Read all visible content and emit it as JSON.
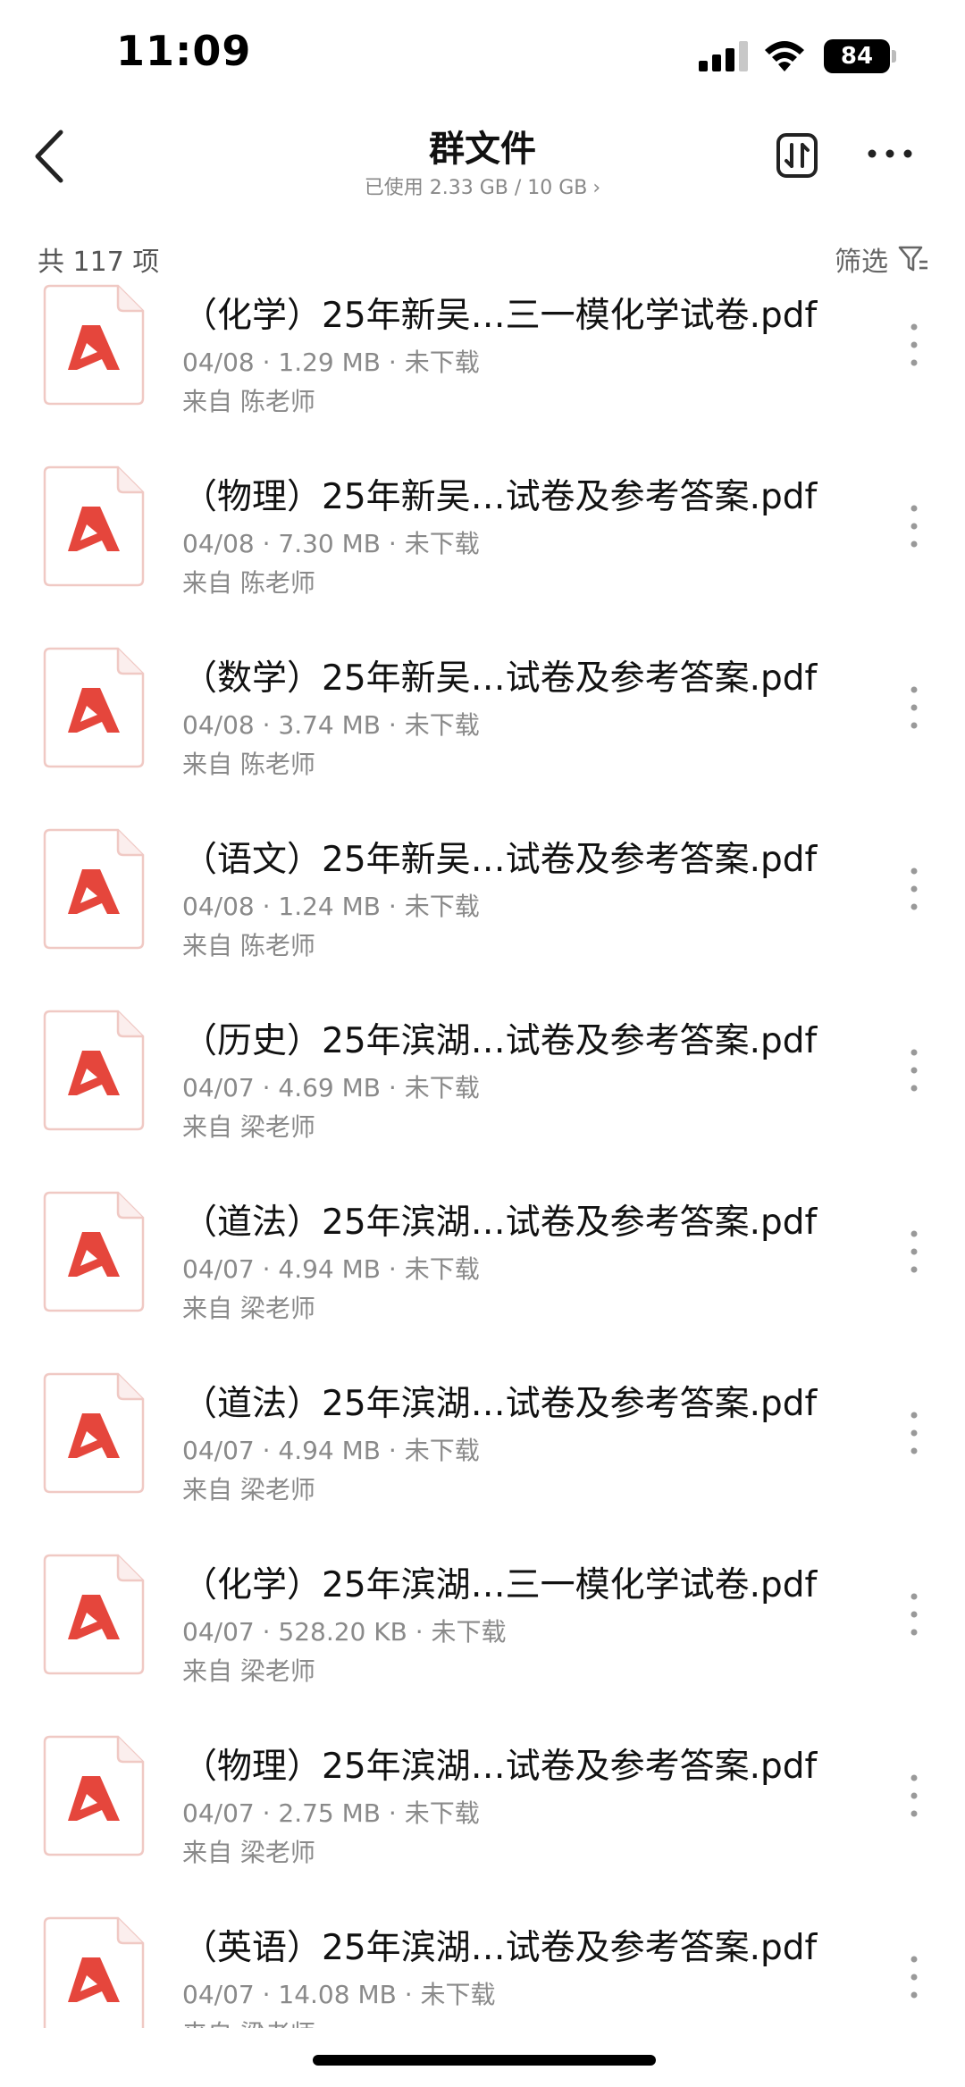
{
  "status_bar": {
    "time": "11:09",
    "battery": "84"
  },
  "nav": {
    "title": "群文件",
    "storage": "已使用 2.33 GB / 10 GB"
  },
  "summary": {
    "count": "共 117 项",
    "filter_label": "筛选"
  },
  "files": [
    {
      "name": "（化学）25年新吴…三一模化学试卷.pdf",
      "meta": "04/08 · 1.29 MB · 未下载",
      "from": "来自 陈老师"
    },
    {
      "name": "（物理）25年新吴…试卷及参考答案.pdf",
      "meta": "04/08 · 7.30 MB · 未下载",
      "from": "来自 陈老师"
    },
    {
      "name": "（数学）25年新吴…试卷及参考答案.pdf",
      "meta": "04/08 · 3.74 MB · 未下载",
      "from": "来自 陈老师"
    },
    {
      "name": "（语文）25年新吴…试卷及参考答案.pdf",
      "meta": "04/08 · 1.24 MB · 未下载",
      "from": "来自 陈老师"
    },
    {
      "name": "（历史）25年滨湖…试卷及参考答案.pdf",
      "meta": "04/07 · 4.69 MB · 未下载",
      "from": "来自 梁老师"
    },
    {
      "name": "（道法）25年滨湖…试卷及参考答案.pdf",
      "meta": "04/07 · 4.94 MB · 未下载",
      "from": "来自 梁老师"
    },
    {
      "name": "（道法）25年滨湖…试卷及参考答案.pdf",
      "meta": "04/07 · 4.94 MB · 未下载",
      "from": "来自 梁老师"
    },
    {
      "name": "（化学）25年滨湖…三一模化学试卷.pdf",
      "meta": "04/07 · 528.20 KB · 未下载",
      "from": "来自 梁老师"
    },
    {
      "name": "（物理）25年滨湖…试卷及参考答案.pdf",
      "meta": "04/07 · 2.75 MB · 未下载",
      "from": "来自 梁老师"
    },
    {
      "name": "（英语）25年滨湖…试卷及参考答案.pdf",
      "meta": "04/07 · 14.08 MB · 未下载",
      "from": "来自 梁老师"
    }
  ],
  "icons": {
    "back": "chevron-left-icon",
    "sort": "sort-icon",
    "more": "more-horizontal-icon",
    "filter": "filter-icon",
    "file": "pdf-file-icon",
    "item_more": "more-vertical-icon"
  },
  "colors": {
    "pdf_red": "#e5463c",
    "pdf_border": "#f0c9c4",
    "meta_gray": "#8a8a8a"
  }
}
